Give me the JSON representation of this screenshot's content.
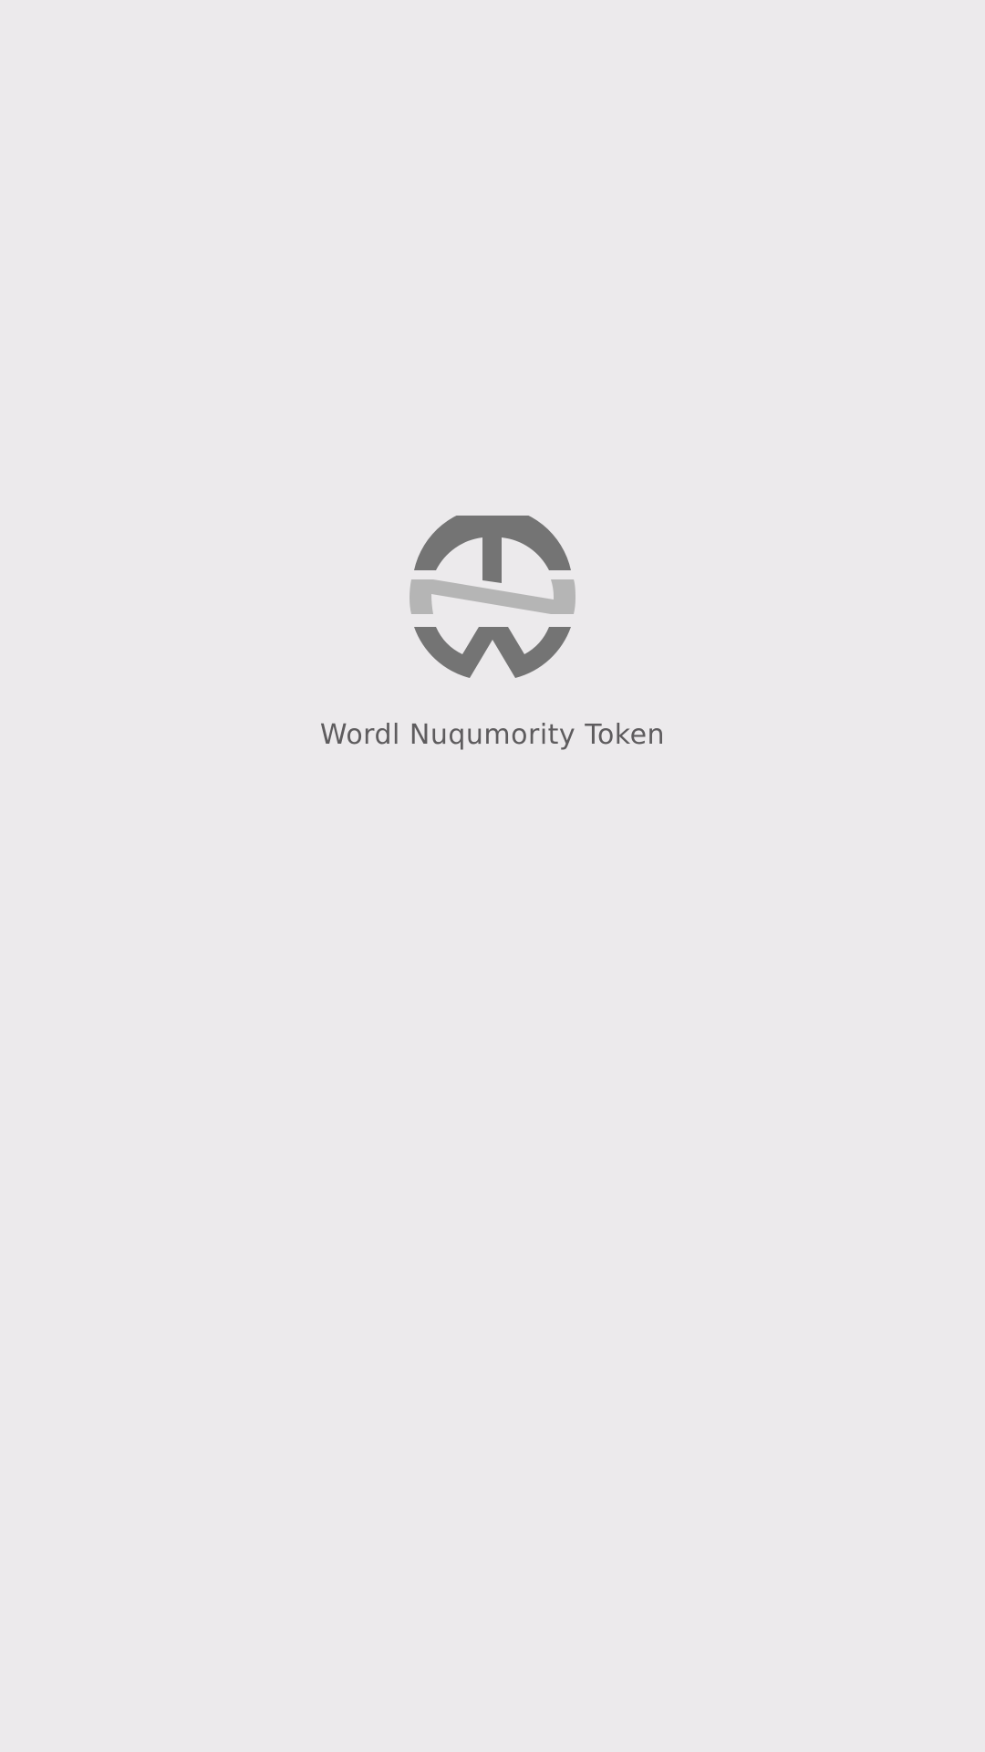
{
  "app": {
    "title": "Wordl Nuqumority Token",
    "logo_icon": "wnt-coin-logo-icon"
  },
  "colors": {
    "background": "#ECEAEC",
    "logo_dark": "#747474",
    "logo_light": "#B5B5B5",
    "title_text": "#5E5C5E"
  }
}
